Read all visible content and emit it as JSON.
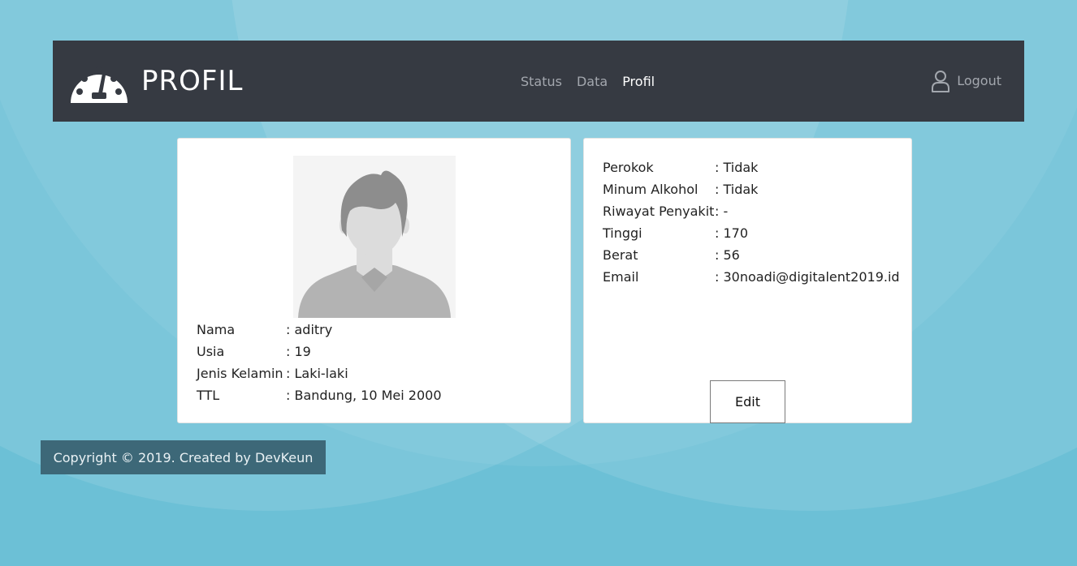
{
  "header": {
    "brand_title": "PROFIL",
    "logo_icon": "speedometer-icon",
    "nav": [
      {
        "label": "Status",
        "active": false
      },
      {
        "label": "Data",
        "active": false
      },
      {
        "label": "Profil",
        "active": true
      }
    ],
    "logout_label": "Logout",
    "logout_icon": "user-icon"
  },
  "profile": {
    "avatar_icon": "default-avatar-icon",
    "fields": [
      {
        "label": "Nama",
        "value": ": aditry"
      },
      {
        "label": "Usia",
        "value": ": 19"
      },
      {
        "label": "Jenis Kelamin",
        "value": ": Laki-laki"
      },
      {
        "label": "TTL",
        "value": ": Bandung, 10 Mei 2000"
      }
    ]
  },
  "health": {
    "fields": [
      {
        "label": "Perokok",
        "value": ": Tidak"
      },
      {
        "label": "Minum Alkohol",
        "value": ": Tidak"
      },
      {
        "label": "Riwayat Penyakit",
        "value": ": -"
      },
      {
        "label": "Tinggi",
        "value": ": 170"
      },
      {
        "label": "Berat",
        "value": ": 56"
      },
      {
        "label": "Email",
        "value": ": 30noadi@digitalent2019.id"
      }
    ],
    "edit_label": "Edit"
  },
  "footer": {
    "copyright": "Copyright © 2019. Created by DevKeun"
  },
  "colors": {
    "navbar": "#363a42",
    "background": "#6cc0d6",
    "footer": "#3d6878"
  }
}
